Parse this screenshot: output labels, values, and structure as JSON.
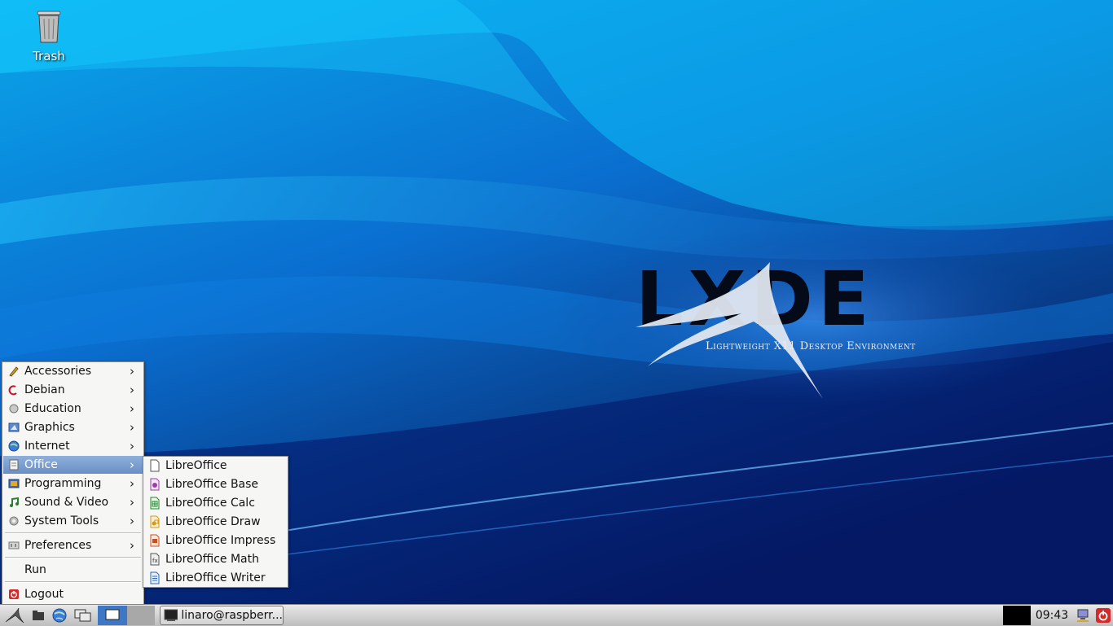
{
  "desktop": {
    "trash_label": "Trash",
    "logo_text": "LXDE",
    "logo_tagline": "Lightweight X11 Desktop Environment"
  },
  "main_menu": {
    "items": [
      {
        "label": "Accessories",
        "icon": "accessories-icon",
        "submenu": true
      },
      {
        "label": "Debian",
        "icon": "debian-icon",
        "submenu": true
      },
      {
        "label": "Education",
        "icon": "education-icon",
        "submenu": true
      },
      {
        "label": "Graphics",
        "icon": "graphics-icon",
        "submenu": true
      },
      {
        "label": "Internet",
        "icon": "internet-icon",
        "submenu": true
      },
      {
        "label": "Office",
        "icon": "office-icon",
        "submenu": true,
        "active": true
      },
      {
        "label": "Programming",
        "icon": "programming-icon",
        "submenu": true
      },
      {
        "label": "Sound & Video",
        "icon": "sound-video-icon",
        "submenu": true
      },
      {
        "label": "System Tools",
        "icon": "system-tools-icon",
        "submenu": true
      }
    ],
    "preferences": "Preferences",
    "run": "Run",
    "logout": "Logout"
  },
  "office_menu": {
    "items": [
      {
        "label": "LibreOffice",
        "icon": "libreoffice-icon"
      },
      {
        "label": "LibreOffice Base",
        "icon": "libreoffice-base-icon"
      },
      {
        "label": "LibreOffice Calc",
        "icon": "libreoffice-calc-icon"
      },
      {
        "label": "LibreOffice Draw",
        "icon": "libreoffice-draw-icon"
      },
      {
        "label": "LibreOffice Impress",
        "icon": "libreoffice-impress-icon"
      },
      {
        "label": "LibreOffice Math",
        "icon": "libreoffice-math-icon"
      },
      {
        "label": "LibreOffice Writer",
        "icon": "libreoffice-writer-icon"
      }
    ]
  },
  "taskbar": {
    "task_title": "linaro@raspberr...",
    "clock": "09:43"
  },
  "colors": {
    "menu_highlight": "#7a9ccf",
    "base_icon": "#9b3fa8",
    "calc_icon": "#1e8a2a",
    "draw_icon": "#d49a12",
    "impress_icon": "#c8501e",
    "writer_icon": "#2a6bb5",
    "logout_icon": "#d42a2a"
  }
}
